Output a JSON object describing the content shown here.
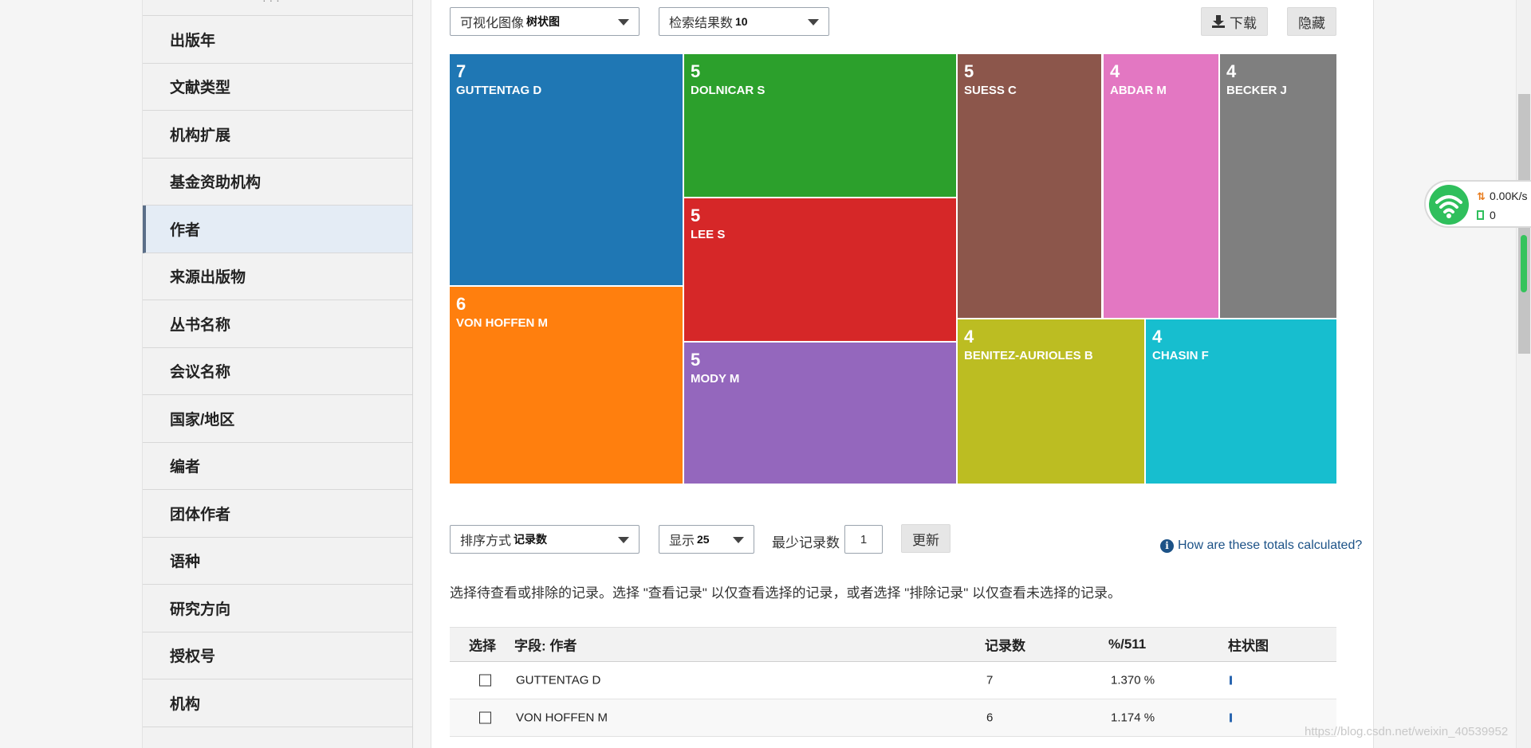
{
  "sidebar": {
    "top_partial": "· · ·",
    "items": [
      {
        "label": "出版年",
        "active": false
      },
      {
        "label": "文献类型",
        "active": false
      },
      {
        "label": "机构扩展",
        "active": false
      },
      {
        "label": "基金资助机构",
        "active": false
      },
      {
        "label": "作者",
        "active": true
      },
      {
        "label": "来源出版物",
        "active": false
      },
      {
        "label": "丛书名称",
        "active": false
      },
      {
        "label": "会议名称",
        "active": false
      },
      {
        "label": "国家/地区",
        "active": false
      },
      {
        "label": "编者",
        "active": false
      },
      {
        "label": "团体作者",
        "active": false
      },
      {
        "label": "语种",
        "active": false
      },
      {
        "label": "研究方向",
        "active": false
      },
      {
        "label": "授权号",
        "active": false
      },
      {
        "label": "机构",
        "active": false
      }
    ]
  },
  "viz": {
    "type_label": "可视化图像",
    "type_value": "树状图",
    "count_label": "检索结果数",
    "count_value": "10",
    "download_label": "下载",
    "hide_label": "隐藏"
  },
  "chart_data": {
    "type": "treemap",
    "items": [
      {
        "label": "GUTTENTAG D",
        "value": 7,
        "color": "#1f77b4"
      },
      {
        "label": "VON HOFFEN M",
        "value": 6,
        "color": "#ff7f0e"
      },
      {
        "label": "DOLNICAR S",
        "value": 5,
        "color": "#2ca02c"
      },
      {
        "label": "LEE S",
        "value": 5,
        "color": "#d62728"
      },
      {
        "label": "MODY M",
        "value": 5,
        "color": "#9467bd"
      },
      {
        "label": "SUESS C",
        "value": 5,
        "color": "#8c564b"
      },
      {
        "label": "ABDAR M",
        "value": 4,
        "color": "#e377c2"
      },
      {
        "label": "BECKER J",
        "value": 4,
        "color": "#7f7f7f"
      },
      {
        "label": "BENITEZ-AURIOLES B",
        "value": 4,
        "color": "#bcbd22"
      },
      {
        "label": "CHASIN F",
        "value": 4,
        "color": "#17becf"
      }
    ]
  },
  "controls": {
    "sort_label": "排序方式",
    "sort_value": "记录数",
    "show_label": "显示",
    "show_value": "25",
    "min_label": "最少记录数",
    "min_value": "1",
    "update_label": "更新",
    "help_text": "How are these totals calculated?",
    "instructions": "选择待查看或排除的记录。选择 \"查看记录\" 以仅查看选择的记录，或者选择 \"排除记录\" 以仅查看未选择的记录。"
  },
  "table": {
    "headers": {
      "select": "选择",
      "field": "字段: 作者",
      "count": "记录数",
      "percent": "%/511",
      "bar": "柱状图"
    },
    "rows": [
      {
        "name": "GUTTENTAG D",
        "count": "7",
        "percent": "1.370 %"
      },
      {
        "name": "VON HOFFEN M",
        "count": "6",
        "percent": "1.174 %"
      }
    ]
  },
  "network_widget": {
    "speed": "0.00K/s",
    "count": "0"
  },
  "watermark": "https://blog.csdn.net/weixin_40539952"
}
